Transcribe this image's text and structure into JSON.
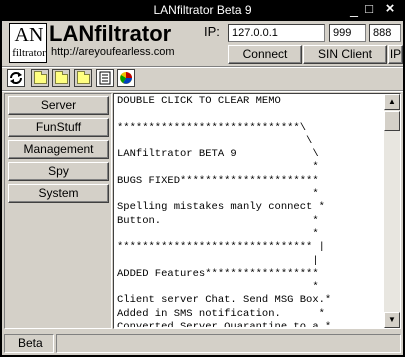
{
  "window": {
    "title": "LANfiltrator Beta 9",
    "minimize_glyph": "_",
    "maximize_glyph": "□",
    "close_glyph": "×"
  },
  "header": {
    "logo_top": "AN",
    "logo_bottom": "filtrator",
    "brand": "LANfiltrator",
    "url": "http://areyoufearless.com",
    "ip_label": "IP:",
    "ip_value": "127.0.0.1",
    "port1_value": "999",
    "port2_value": "888",
    "connect_label": "Connect",
    "sin_client_label": "SIN Client",
    "ip_button_label": "IP"
  },
  "toolbar": {
    "icons": [
      "refresh-icon",
      "folder-icon",
      "folder-icon",
      "folder-icon",
      "document-icon",
      "chart-icon"
    ]
  },
  "menu": {
    "items": [
      {
        "label": "Server"
      },
      {
        "label": "FunStuff"
      },
      {
        "label": "Management"
      },
      {
        "label": "Spy"
      },
      {
        "label": "System"
      }
    ]
  },
  "memo": {
    "text": "DOUBLE CLICK TO CLEAR MEMO\n\n*****************************\\\n                              \\\nLANfiltrator BETA 9            \\\n                               *\nBUGS FIXED**********************\n                               *\nSpelling mistakes manly connect *\nButton.                        *\n                               *\n******************************* |\n                               |\nADDED Features******************\n                               *\nClient server Chat. Send MSG Box.*\nAdded in SMS notification.      *\nConverted Server Quarantine to a *\nFull on Notification could SIN. *\nThe ability to update the server *\nFrom the client with update.    *"
  },
  "scrollbar": {
    "up_glyph": "▲",
    "down_glyph": "▼"
  },
  "statusbar": {
    "panel1": "Beta",
    "panel2": ""
  }
}
